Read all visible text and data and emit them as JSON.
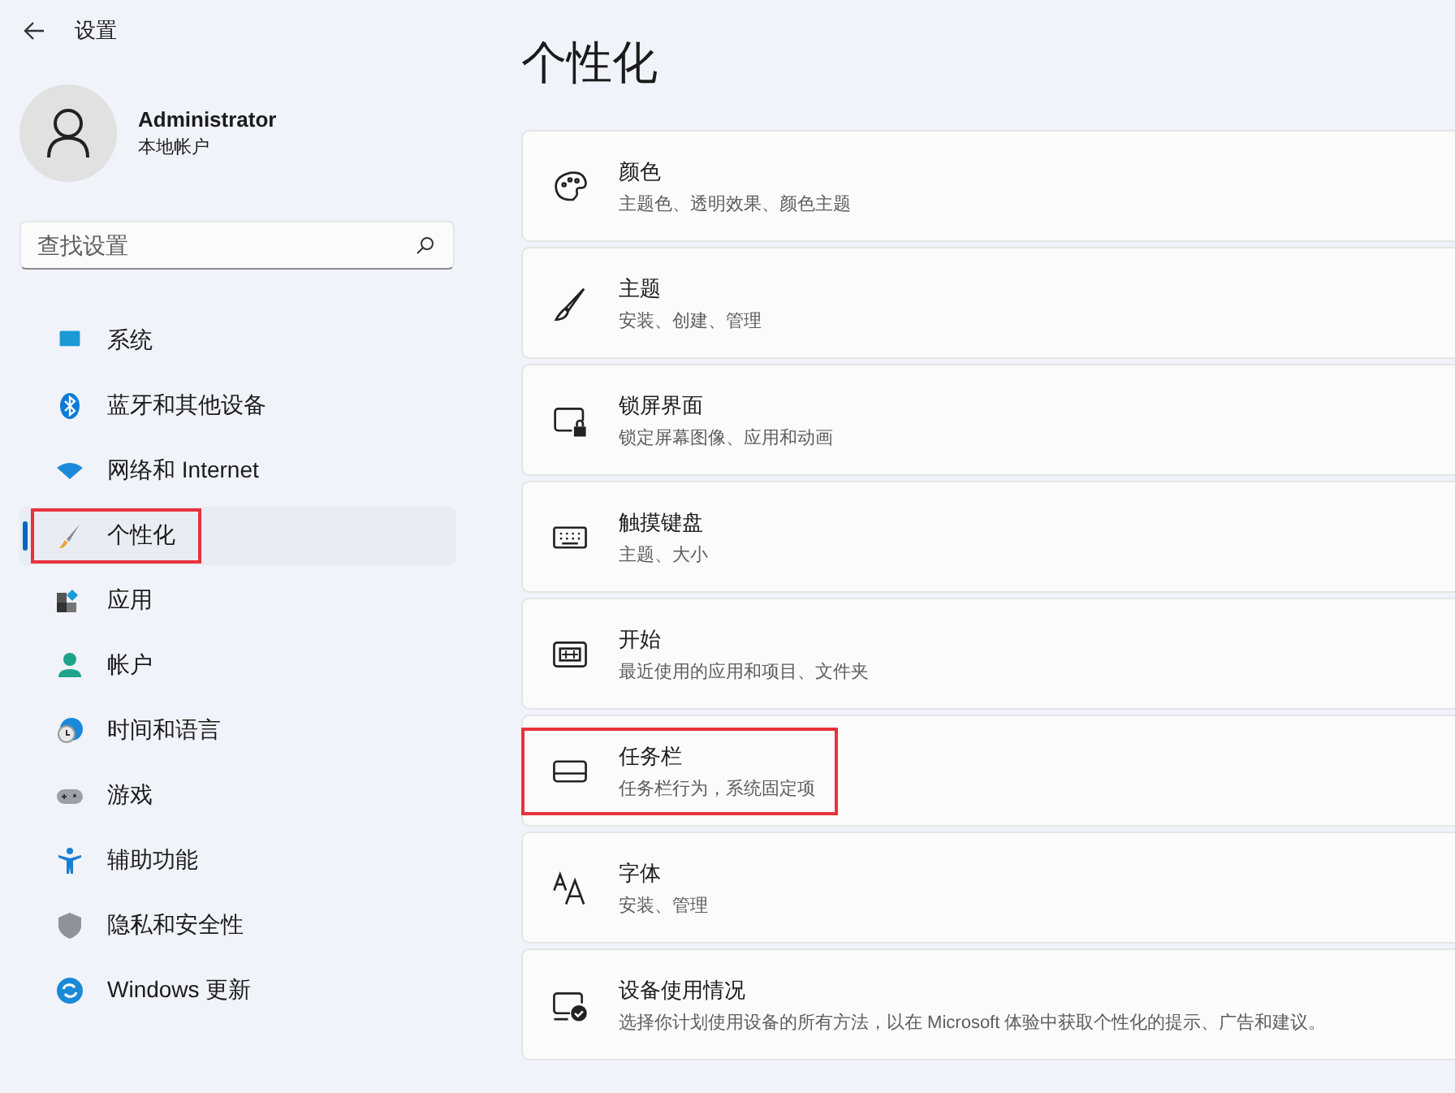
{
  "window": {
    "title": "设置"
  },
  "profile": {
    "name": "Administrator",
    "account": "本地帐户"
  },
  "search": {
    "placeholder": "查找设置"
  },
  "nav": [
    {
      "kind": "system",
      "label": "系统",
      "selected": false,
      "highlighted": false
    },
    {
      "kind": "bluetooth",
      "label": "蓝牙和其他设备",
      "selected": false,
      "highlighted": false
    },
    {
      "kind": "wifi",
      "label": "网络和 Internet",
      "selected": false,
      "highlighted": false
    },
    {
      "kind": "brush",
      "label": "个性化",
      "selected": true,
      "highlighted": true
    },
    {
      "kind": "apps",
      "label": "应用",
      "selected": false,
      "highlighted": false
    },
    {
      "kind": "account",
      "label": "帐户",
      "selected": false,
      "highlighted": false
    },
    {
      "kind": "time",
      "label": "时间和语言",
      "selected": false,
      "highlighted": false
    },
    {
      "kind": "gaming",
      "label": "游戏",
      "selected": false,
      "highlighted": false
    },
    {
      "kind": "accessibility",
      "label": "辅助功能",
      "selected": false,
      "highlighted": false
    },
    {
      "kind": "privacy",
      "label": "隐私和安全性",
      "selected": false,
      "highlighted": false
    },
    {
      "kind": "update",
      "label": "Windows 更新",
      "selected": false,
      "highlighted": false
    }
  ],
  "page_title": "个性化",
  "cards": [
    {
      "kind": "palette",
      "title": "颜色",
      "subtitle": "主题色、透明效果、颜色主题",
      "highlighted": false
    },
    {
      "kind": "brush",
      "title": "主题",
      "subtitle": "安装、创建、管理",
      "highlighted": false
    },
    {
      "kind": "lockscreen",
      "title": "锁屏界面",
      "subtitle": "锁定屏幕图像、应用和动画",
      "highlighted": false
    },
    {
      "kind": "keyboard",
      "title": "触摸键盘",
      "subtitle": "主题、大小",
      "highlighted": false
    },
    {
      "kind": "start",
      "title": "开始",
      "subtitle": "最近使用的应用和项目、文件夹",
      "highlighted": false
    },
    {
      "kind": "taskbar",
      "title": "任务栏",
      "subtitle": "任务栏行为，系统固定项",
      "highlighted": true
    },
    {
      "kind": "fonts",
      "title": "字体",
      "subtitle": "安装、管理",
      "highlighted": false
    },
    {
      "kind": "device",
      "title": "设备使用情况",
      "subtitle": "选择你计划使用设备的所有方法，以在 Microsoft 体验中获取个性化的提示、广告和建议。",
      "highlighted": false
    }
  ]
}
